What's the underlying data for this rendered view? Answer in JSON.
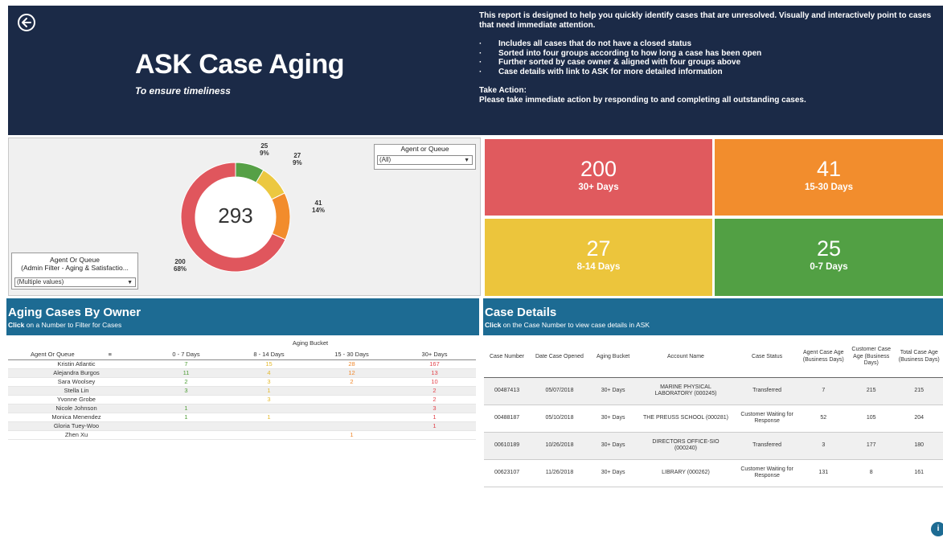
{
  "header": {
    "title": "ASK Case Aging",
    "subtitle": "To ensure timeliness",
    "intro": "This report is designed to help you quickly identify cases that are unresolved.  Visually and interactively point to cases that need immediate attention.",
    "bullets": [
      "Includes all cases that do not have a closed status",
      "Sorted into four groups according to how long a case has been open",
      "Further sorted by case owner & aligned with four groups above",
      "Case details with link to ASK for more detailed information"
    ],
    "take_action_label": "Take Action:",
    "take_action_text": "Please take immediate action by responding to and completing all outstanding cases."
  },
  "donut": {
    "total": "293",
    "segments": [
      {
        "value": 200,
        "count_label": "200",
        "pct_label": "68%",
        "color": "#e0565d"
      },
      {
        "value": 41,
        "count_label": "41",
        "pct_label": "14%",
        "color": "#f28c2c"
      },
      {
        "value": 27,
        "count_label": "27",
        "pct_label": "9%",
        "color": "#ecc840"
      },
      {
        "value": 25,
        "count_label": "25",
        "pct_label": "9%",
        "color": "#56a046"
      }
    ]
  },
  "filters": {
    "agent_or_queue": {
      "title": "Agent or Queue",
      "value": "(All)"
    },
    "admin_filter": {
      "title_line1": "Agent Or Queue",
      "title_line2": "(Admin Filter - Aging & Satisfactio...",
      "value": "(Multiple values)"
    }
  },
  "kpis": [
    {
      "num": "200",
      "label": "30+ Days",
      "color": "#e05a5e"
    },
    {
      "num": "41",
      "label": "15-30 Days",
      "color": "#f28d2d"
    },
    {
      "num": "27",
      "label": "8-14 Days",
      "color": "#ecc53c"
    },
    {
      "num": "25",
      "label": "0-7 Days",
      "color": "#52a044"
    }
  ],
  "owners_section": {
    "title": "Aging Cases By Owner",
    "hint_bold": "Click",
    "hint_rest": " on a Number to Filter for Cases",
    "bucket_header": "Aging Bucket",
    "col_owner": "Agent Or Queue",
    "col_headers": [
      "0 - 7 Days",
      "8 - 14 Days",
      "15 - 30 Days",
      "30+ Days"
    ],
    "rows": [
      {
        "name": "Kristin Atlantic",
        "d0": "7",
        "d8": "15",
        "d15": "28",
        "d30": "167"
      },
      {
        "name": "Alejandra Burgos",
        "d0": "11",
        "d8": "4",
        "d15": "12",
        "d30": "13"
      },
      {
        "name": "Sara Woolsey",
        "d0": "2",
        "d8": "3",
        "d15": "2",
        "d30": "10"
      },
      {
        "name": "Stella Lin",
        "d0": "3",
        "d8": "1",
        "d15": "",
        "d30": "2"
      },
      {
        "name": "Yvonne Grobe",
        "d0": "",
        "d8": "3",
        "d15": "",
        "d30": "2"
      },
      {
        "name": "Nicole Johnson",
        "d0": "1",
        "d8": "",
        "d15": "",
        "d30": "3"
      },
      {
        "name": "Monica Menendez",
        "d0": "1",
        "d8": "1",
        "d15": "",
        "d30": "1"
      },
      {
        "name": "Gloria Tuey-Woo",
        "d0": "",
        "d8": "",
        "d15": "",
        "d30": "1"
      },
      {
        "name": "Zhen Xu",
        "d0": "",
        "d8": "",
        "d15": "1",
        "d30": ""
      }
    ]
  },
  "case_section": {
    "title": "Case Details",
    "hint_bold": "Click",
    "hint_rest": " on the Case Number to view case details in ASK",
    "headers": {
      "case_number": "Case Number",
      "date_opened": "Date Case Opened",
      "aging_bucket": "Aging Bucket",
      "account_name": "Account Name",
      "case_status": "Case Status",
      "agent_age": "Agent Case Age (Business Days)",
      "customer_age": "Customer Case Age (Business Days)",
      "total_age": "Total Case Age (Business Days)"
    },
    "rows": [
      {
        "num": "00487413",
        "opened": "05/07/2018",
        "bucket": "30+ Days",
        "account": "MARINE PHYSICAL LABORATORY (000245)",
        "status": "Transferred",
        "agent": "7",
        "customer": "215",
        "total": "215"
      },
      {
        "num": "00488187",
        "opened": "05/10/2018",
        "bucket": "30+ Days",
        "account": "THE PREUSS SCHOOL (000281)",
        "status": "Customer Waiting for Response",
        "agent": "52",
        "customer": "105",
        "total": "204"
      },
      {
        "num": "00610189",
        "opened": "10/26/2018",
        "bucket": "30+ Days",
        "account": "DIRECTORS OFFICE-SIO (000240)",
        "status": "Transferred",
        "agent": "3",
        "customer": "177",
        "total": "180"
      },
      {
        "num": "00623107",
        "opened": "11/26/2018",
        "bucket": "30+ Days",
        "account": "LIBRARY (000262)",
        "status": "Customer Waiting for Response",
        "agent": "131",
        "customer": "8",
        "total": "161"
      }
    ]
  }
}
